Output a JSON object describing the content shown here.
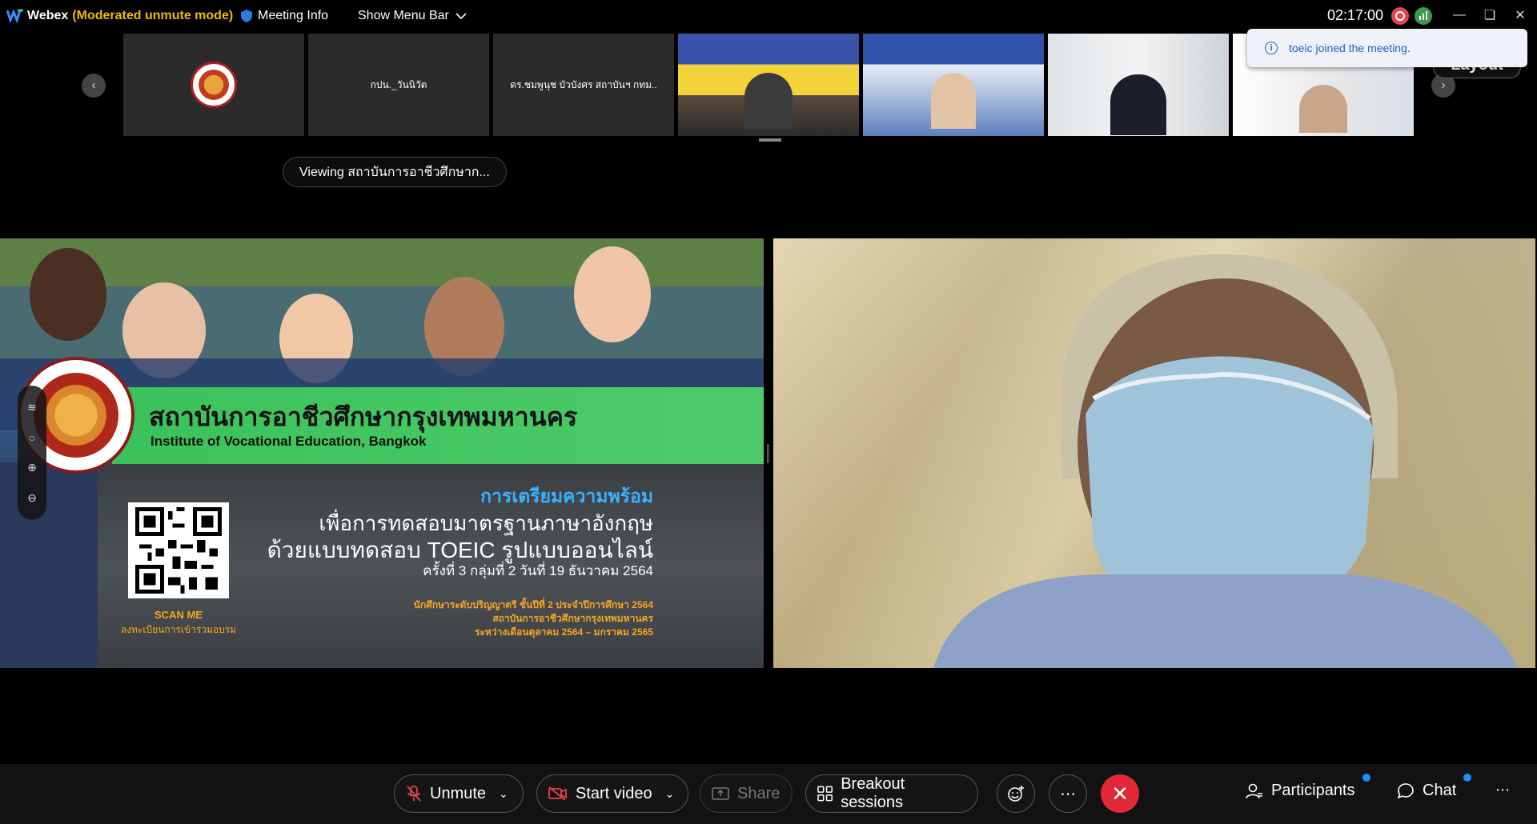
{
  "titlebar": {
    "app_name": "Webex",
    "mode": "(Moderated unmute mode)",
    "meeting_info": "Meeting Info",
    "show_menu_bar": "Show Menu Bar",
    "time": "02:17:00"
  },
  "filmstrip": {
    "tiles": [
      {
        "label": ""
      },
      {
        "label": "กปน._วันนิวัต"
      },
      {
        "label": "ดร.ชมพูนุช บัวบังศร สถาบันฯ กทม.."
      },
      {
        "label": ""
      },
      {
        "label": ""
      },
      {
        "label": ""
      },
      {
        "label": ""
      }
    ]
  },
  "toast": {
    "message": "toeic joined the meeting."
  },
  "layout_label": "Layout",
  "viewing": "Viewing สถาบันการอาชีวศึกษาก...",
  "slide": {
    "title_th": "สถาบันการอาชีวศึกษากรุงเทพมหานคร",
    "title_en": "Institute of Vocational Education, Bangkok",
    "prep": "การเตรียมความพร้อม",
    "line1": "เพื่อการทดสอบมาตรฐานภาษาอังกฤษ",
    "line2": "ด้วยแบบทดสอบ TOEIC รูปแบบออนไลน์",
    "line3": "ครั้งที่ 3 กลุ่มที่ 2 วันที่ 19 ธันวาคม 2564",
    "scan_me": "SCAN ME",
    "scan_sub": "ลงทะเบียนการเข้าร่วมอบรม",
    "foot1": "นักศึกษาระดับปริญญาตรี ชั้นปีที่ 2 ประจำปีการศึกษา 2564",
    "foot2": "สถาบันการอาชีวศึกษากรุงเทพมหานคร",
    "foot3": "ระหว่างเดือนตุลาคม 2564 – มกราคม 2565"
  },
  "controls": {
    "unmute": "Unmute",
    "start_video": "Start video",
    "share": "Share",
    "breakout": "Breakout sessions",
    "participants": "Participants",
    "chat": "Chat"
  },
  "colors": {
    "mode": "#f5b700",
    "end_call": "#e02836",
    "slide_green": "#3cc25a",
    "accent_blue": "#1f8cff"
  }
}
